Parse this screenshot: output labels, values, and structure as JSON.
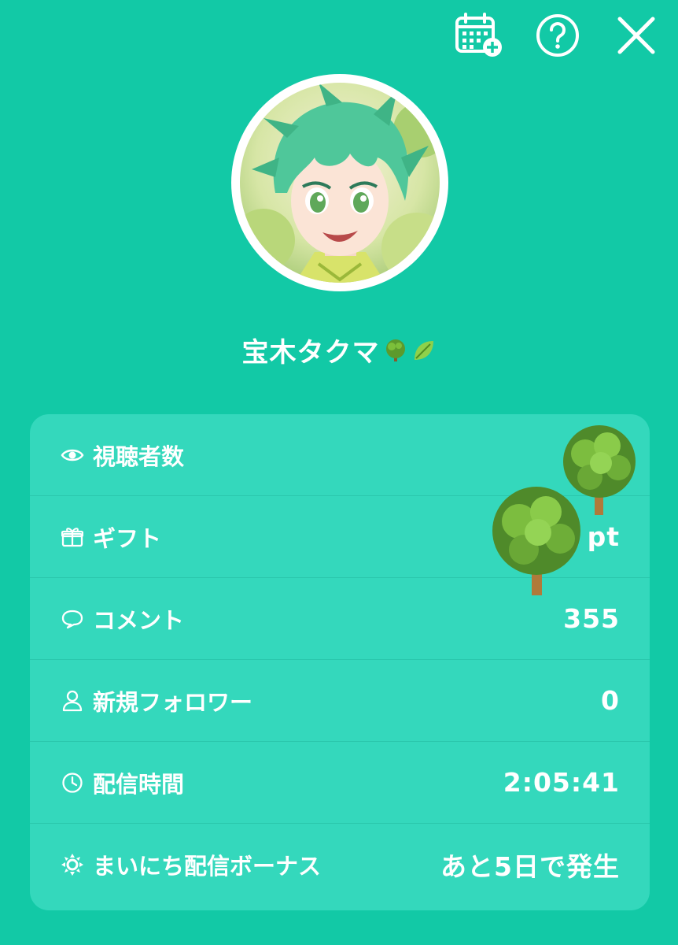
{
  "header": {
    "icons": [
      "calendar-add-icon",
      "help-icon",
      "close-icon"
    ]
  },
  "profile": {
    "username": "宝木タクマ",
    "username_emojis": [
      "tree-emoji",
      "leaf-emoji"
    ]
  },
  "stats": [
    {
      "icon": "eye-icon",
      "label": "視聴者数",
      "value": ""
    },
    {
      "icon": "gift-icon",
      "label": "ギフト",
      "value": "pt"
    },
    {
      "icon": "comment-icon",
      "label": "コメント",
      "value": "355"
    },
    {
      "icon": "person-icon",
      "label": "新規フォロワー",
      "value": "0"
    },
    {
      "icon": "clock-icon",
      "label": "配信時間",
      "value": "2:05:41"
    },
    {
      "icon": "sun-icon",
      "label": "まいにち配信ボーナス",
      "value": "あと5日で発生"
    }
  ],
  "colors": {
    "background": "#12c9a6",
    "card": "#34d8bc",
    "text": "#ffffff"
  }
}
